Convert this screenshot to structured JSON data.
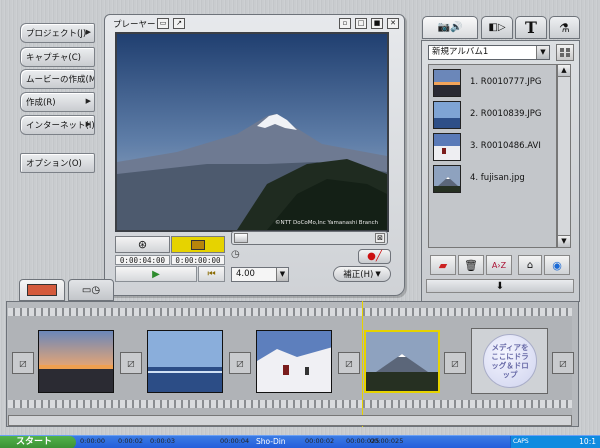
{
  "left_menu": {
    "items": [
      {
        "label": "プロジェクト(J)",
        "has_arrow": true
      },
      {
        "label": "キャプチャ(C)",
        "has_arrow": false
      },
      {
        "label": "ムービーの作成(M)",
        "has_arrow": false
      },
      {
        "label": "作成(R)",
        "has_arrow": true
      },
      {
        "label": "インターネット(I)",
        "has_arrow": true
      }
    ],
    "options_label": "オプション(O)"
  },
  "player": {
    "title": "プレーヤー",
    "watermark": "©NTT DoCoMo,Inc Yamanashi Branch",
    "current_time": "0:00:04:00",
    "total_time": "0:00:00:00",
    "speed_value": "4.00",
    "fix_label": "補正(H)",
    "play_icon": "play-icon",
    "end_icon": "skip-to-end-icon"
  },
  "album": {
    "selected": "新規アルバム1",
    "files": [
      {
        "name": "1. R0010777.JPG",
        "thumb": "sunset"
      },
      {
        "name": "2. R0010839.JPG",
        "thumb": "sea"
      },
      {
        "name": "3. R0010486.AVI",
        "thumb": "snow"
      },
      {
        "name": "4. fujisan.jpg",
        "thumb": "fuji"
      }
    ],
    "tabs": [
      "media-tab",
      "transition-tab",
      "text-tab",
      "effects-tab"
    ]
  },
  "storyboard": {
    "drop_text": "メディアをここにドラッグ＆ドロップ",
    "clips": [
      "sunset",
      "sea",
      "snow",
      "fuji"
    ]
  },
  "taskbar": {
    "start_label": "スタート",
    "items": [
      "Sho-Din"
    ],
    "clock": "10:1",
    "caps": "CAPS",
    "ticks": [
      "0:00:00",
      "0:00:02",
      "0:00:03",
      "00:00:04",
      "00:00:02",
      "00:00:025",
      "00:00:025"
    ]
  },
  "colors": {
    "playhead": "#e6d300",
    "accent_tab": "#d45a3c",
    "selected_clip_border": "#e6d300"
  }
}
